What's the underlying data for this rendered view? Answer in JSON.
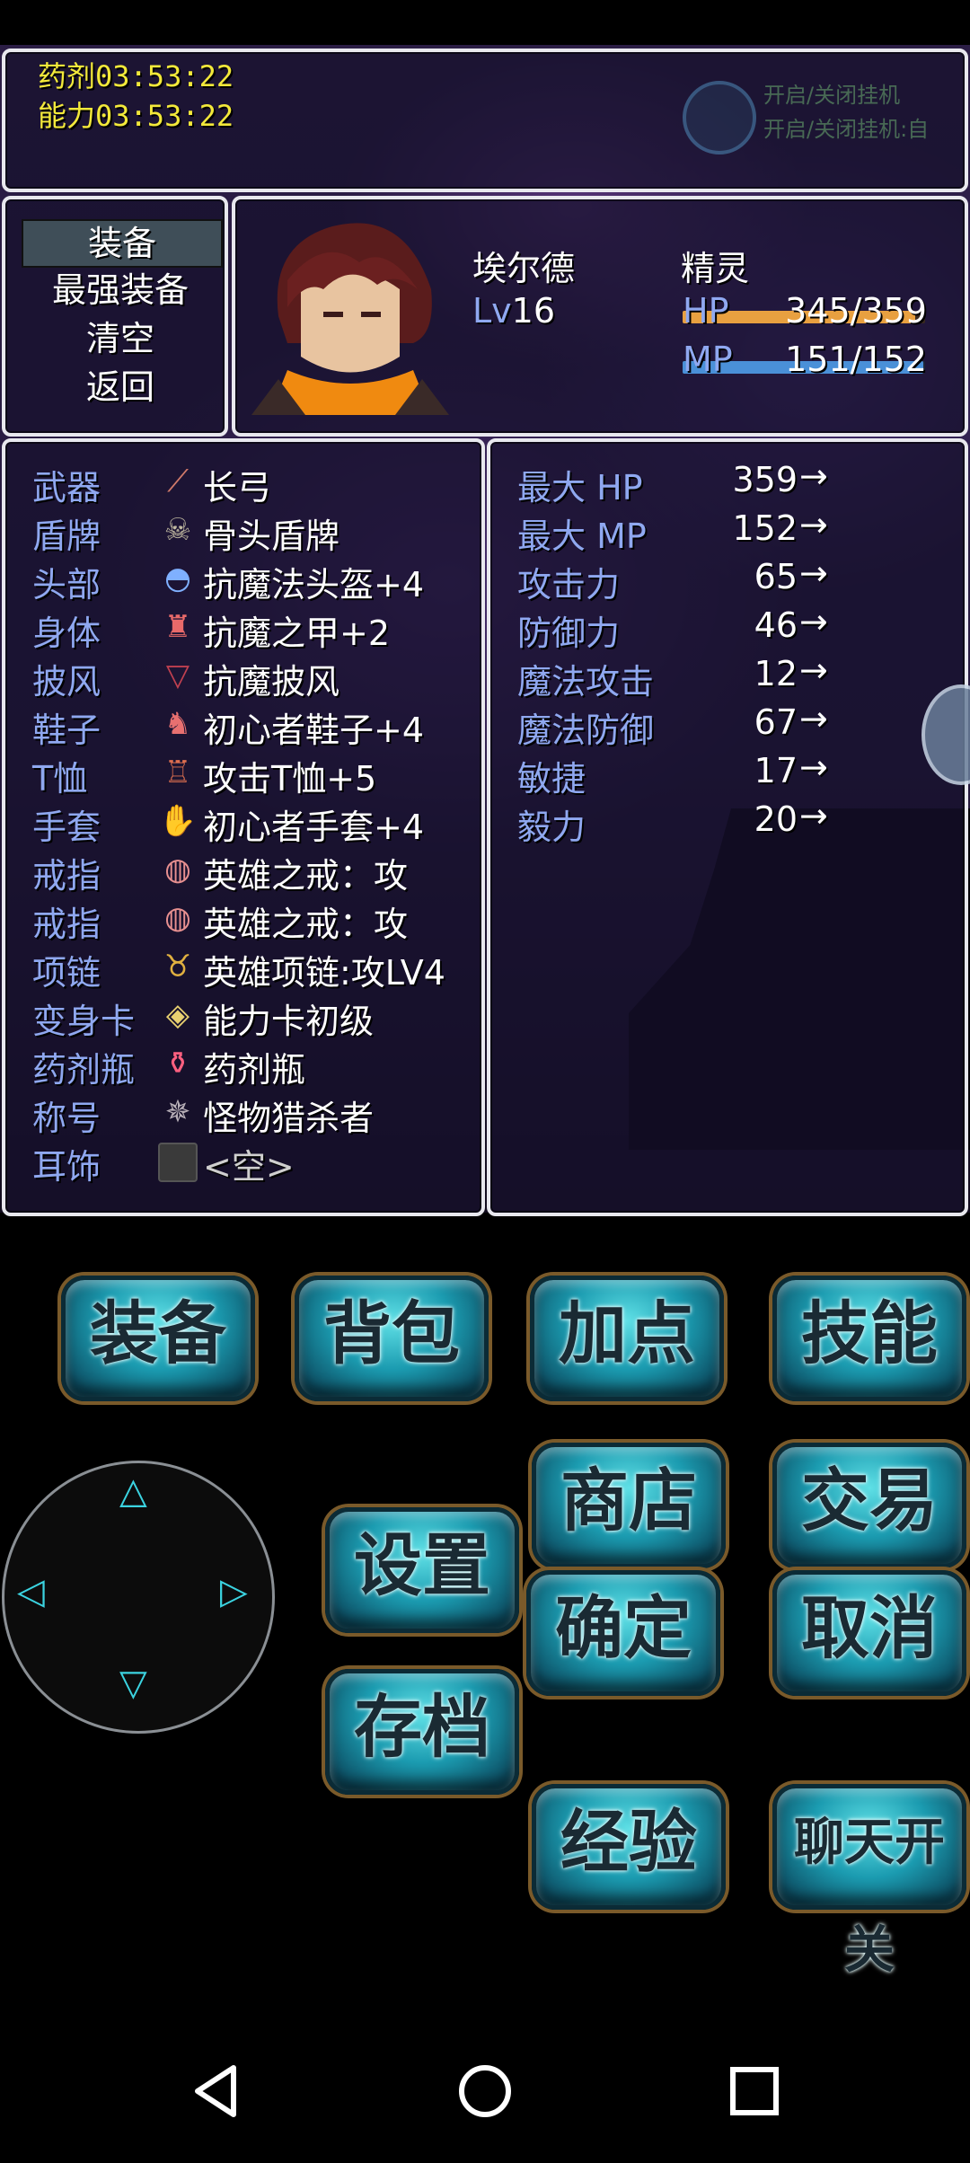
{
  "timers": {
    "potion": "药剂03:53:22",
    "ability": "能力03:53:22"
  },
  "map_overlay": {
    "line1": "开启/关闭挂机",
    "line2": "开启/关闭挂机:自"
  },
  "menu": {
    "items": [
      {
        "label": "装备",
        "selected": true
      },
      {
        "label": "最强装备",
        "selected": false
      },
      {
        "label": "清空",
        "selected": false
      },
      {
        "label": "返回",
        "selected": false
      }
    ]
  },
  "character": {
    "name": "埃尔德",
    "class": "精灵",
    "level_label": "Lv",
    "level": "16",
    "hp_label": "HP",
    "hp": "345/359",
    "hp_fraction": 0.961,
    "mp_label": "MP",
    "mp": "151/152",
    "mp_fraction": 0.993,
    "hp_color": "#e8a040",
    "mp_color": "#4a90d8"
  },
  "equipment": [
    {
      "slot": "武器",
      "item": "长弓",
      "icon": "bow-icon"
    },
    {
      "slot": "盾牌",
      "item": "骨头盾牌",
      "icon": "skull-shield-icon"
    },
    {
      "slot": "头部",
      "item": "抗魔法头盔+4",
      "icon": "helmet-icon"
    },
    {
      "slot": "身体",
      "item": "抗魔之甲+2",
      "icon": "armor-icon"
    },
    {
      "slot": "披风",
      "item": "抗魔披风",
      "icon": "cape-icon"
    },
    {
      "slot": "鞋子",
      "item": "初心者鞋子+4",
      "icon": "boots-icon"
    },
    {
      "slot": "T恤",
      "item": "攻击T恤+5",
      "icon": "tshirt-icon"
    },
    {
      "slot": "手套",
      "item": "初心者手套+4",
      "icon": "gloves-icon"
    },
    {
      "slot": "戒指",
      "item": "英雄之戒：攻",
      "icon": "ring-icon"
    },
    {
      "slot": "戒指",
      "item": "英雄之戒：攻",
      "icon": "ring-icon"
    },
    {
      "slot": "项链",
      "item": "英雄项链:攻LV4",
      "icon": "necklace-icon"
    },
    {
      "slot": "变身卡",
      "item": "能力卡初级",
      "icon": "card-icon"
    },
    {
      "slot": "药剂瓶",
      "item": "药剂瓶",
      "icon": "potion-icon"
    },
    {
      "slot": "称号",
      "item": "怪物猎杀者",
      "icon": "monster-title-icon"
    },
    {
      "slot": "耳饰",
      "item": "<空>",
      "icon": "empty-slot-icon"
    }
  ],
  "stats": [
    {
      "name": "最大 HP",
      "value": "359",
      "arrow": "→"
    },
    {
      "name": "最大 MP",
      "value": "152",
      "arrow": "→"
    },
    {
      "name": "攻击力",
      "value": "65",
      "arrow": "→"
    },
    {
      "name": "防御力",
      "value": "46",
      "arrow": "→"
    },
    {
      "name": "魔法攻击",
      "value": "12",
      "arrow": "→"
    },
    {
      "name": "魔法防御",
      "value": "67",
      "arrow": "→"
    },
    {
      "name": "敏捷",
      "value": "17",
      "arrow": "→"
    },
    {
      "name": "毅力",
      "value": "20",
      "arrow": "→"
    }
  ],
  "buttons": {
    "equip": "装备",
    "bag": "背包",
    "add_points": "加点",
    "skills": "技能",
    "shop": "商店",
    "trade": "交易",
    "settings": "设置",
    "confirm": "确定",
    "cancel": "取消",
    "save": "存档",
    "exp": "经验",
    "chat_toggle": "聊天开关"
  },
  "dpad": {
    "up": "△",
    "down": "▽",
    "left": "◁",
    "right": "▷"
  },
  "nav": {
    "back": "back-icon",
    "home": "home-icon",
    "recents": "recents-icon"
  }
}
